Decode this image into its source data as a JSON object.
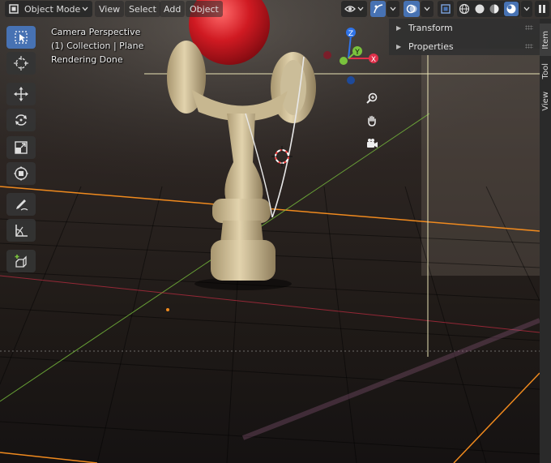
{
  "header": {
    "mode_label": "Object Mode",
    "menus": [
      "View",
      "Select",
      "Add",
      "Object"
    ]
  },
  "overlay": {
    "line1": "Camera Perspective",
    "line2": "(1) Collection | Plane",
    "line3": "Rendering Done"
  },
  "gizmo": {
    "x": "X",
    "y": "Y",
    "z": "Z"
  },
  "npanel": {
    "sections": [
      {
        "label": "Transform"
      },
      {
        "label": "Properties"
      }
    ]
  },
  "sidebar_tabs": [
    "Item",
    "Tool",
    "View"
  ],
  "colors": {
    "accent": "#4772b3",
    "x_axis": "#e0304a",
    "y_axis": "#7ac23d",
    "z_axis": "#2f73e8",
    "selection_orange": "#f08a1e"
  },
  "icons": {
    "toolbar": [
      "select-box-icon",
      "cursor-icon",
      "move-icon",
      "rotate-icon",
      "scale-icon",
      "transform-icon",
      "annotate-icon",
      "measure-icon",
      "add-cube-icon"
    ],
    "nav": [
      "zoom-icon",
      "hand-pan-icon",
      "camera-view-icon"
    ]
  }
}
